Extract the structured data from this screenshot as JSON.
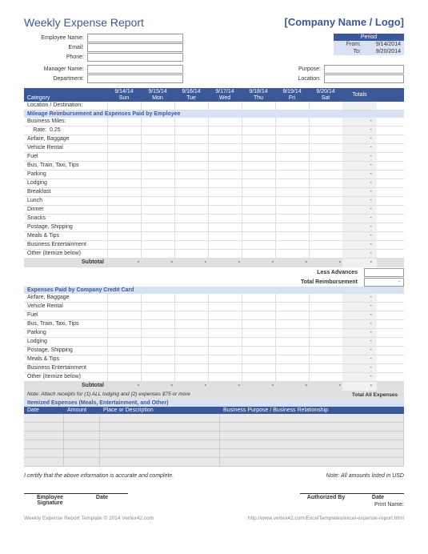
{
  "title": "Weekly Expense Report",
  "company": "[Company Name / Logo]",
  "period": {
    "header": "Period",
    "from_lbl": "From:",
    "from": "9/14/2014",
    "to_lbl": "To:",
    "to": "9/20/2014"
  },
  "emp": {
    "name_lbl": "Employee Name:",
    "email_lbl": "Email:",
    "phone_lbl": "Phone:",
    "mgr_lbl": "Manager Name:",
    "dept_lbl": "Department:",
    "purpose_lbl": "Purpose:",
    "loc_lbl": "Location:"
  },
  "cat_header": "Category",
  "days": [
    {
      "date": "9/14/14",
      "dow": "Sun"
    },
    {
      "date": "9/15/14",
      "dow": "Mon"
    },
    {
      "date": "9/16/14",
      "dow": "Tue"
    },
    {
      "date": "9/17/14",
      "dow": "Wed"
    },
    {
      "date": "9/18/14",
      "dow": "Thu"
    },
    {
      "date": "9/19/14",
      "dow": "Fri"
    },
    {
      "date": "9/20/14",
      "dow": "Sat"
    }
  ],
  "totals_lbl": "Totals",
  "location_dest": "Location / Destination:",
  "section1": "Mileage Reimbursement and Expenses Paid by Employee",
  "biz_miles": "Business Miles:",
  "rate_lbl": "Rate:",
  "rate_val": "0.25",
  "rows1": [
    "Airfare, Baggage",
    "Vehicle Rental",
    "Fuel",
    "Bus, Train, Taxi, Tips",
    "Parking",
    "Lodging",
    "Breakfast",
    "Lunch",
    "Dinner",
    "Snacks",
    "Postage, Shipping",
    "Meals & Tips",
    "Business Entertainment",
    "Other (Itemize below)"
  ],
  "subtotal": "Subtotal",
  "less_adv": "Less Advances",
  "tot_reimb": "Total Reimbursement",
  "section2": "Expenses Paid by Company Credit Card",
  "rows2": [
    "Airfare, Baggage",
    "Vehicle Rental",
    "Fuel",
    "Bus, Train, Taxi, Tips",
    "Parking",
    "Lodging",
    "Postage, Shipping",
    "Meals & Tips",
    "Business Entertainment",
    "Other (Itemize below)"
  ],
  "note": "Note: Attach receipts for (1) ALL lodging and (2) expenses $75 or more",
  "tot_all": "Total All Expenses",
  "section3": "Itemized Expenses (Meals, Entertainment, and Other)",
  "it_cols": {
    "c1": "Date",
    "c2": "Amount",
    "c3": "Place or Description",
    "c4": "Business Purpose / Business Relationship"
  },
  "cert": "I certify that the above information is accurate and complete.",
  "note_usd": "Note: All amounts listed in USD",
  "sig1": "Employee Signature",
  "sig2": "Authorized By",
  "sig_date": "Date",
  "print_name": "Print Name:",
  "footer_l": "Weekly Expense Report Template © 2014 Vertex42.com",
  "footer_r": "http://www.vertex42.com/ExcelTemplates/excel-expense-report.html",
  "dash": "-"
}
